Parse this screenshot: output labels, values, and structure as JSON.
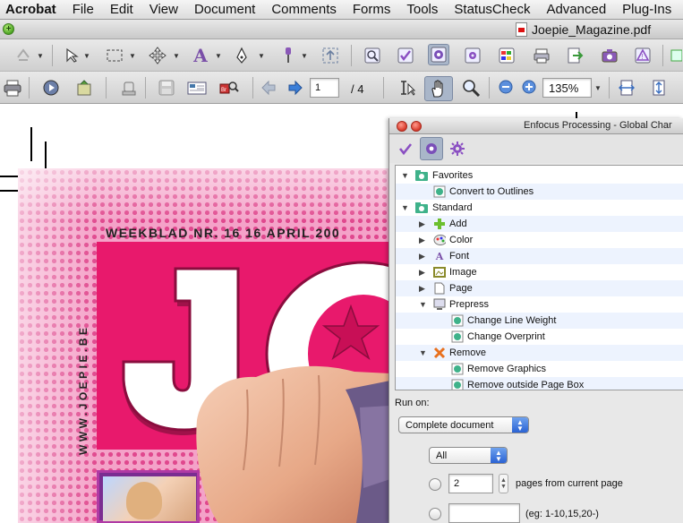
{
  "menubar": {
    "app": "Acrobat",
    "items": [
      "File",
      "Edit",
      "View",
      "Document",
      "Comments",
      "Forms",
      "Tools",
      "StatusCheck",
      "Advanced",
      "Plug-Ins"
    ]
  },
  "window": {
    "filename": "Joepie_Magazine.pdf"
  },
  "toolbar2": {
    "page_current": "1",
    "page_separator": "/ 4",
    "zoom_value": "135%"
  },
  "document": {
    "header_text": "WEEKBLAD NR. 16   16 APRIL 200",
    "vertical_url": "WWW.JOEPIE.BE"
  },
  "panel": {
    "title": "Enfocus Processing - Global Char",
    "tree": {
      "favorites_label": "Favorites",
      "convert_outlines": "Convert to Outlines",
      "standard_label": "Standard",
      "add": "Add",
      "color": "Color",
      "font": "Font",
      "image": "Image",
      "page": "Page",
      "prepress": "Prepress",
      "change_line_weight": "Change Line Weight",
      "change_overprint": "Change Overprint",
      "remove": "Remove",
      "remove_graphics": "Remove Graphics",
      "remove_outside": "Remove outside Page Box"
    },
    "run_on_label": "Run on:",
    "run_on_value": "Complete document",
    "filter_value": "All",
    "pages_value": "2",
    "pages_label": "pages from current page",
    "range_hint": "(eg: 1-10,15,20-)"
  },
  "colors": {
    "accent": "#2a62d4",
    "magenta": "#e8196c",
    "selected_tool": "#a9b6c9"
  }
}
